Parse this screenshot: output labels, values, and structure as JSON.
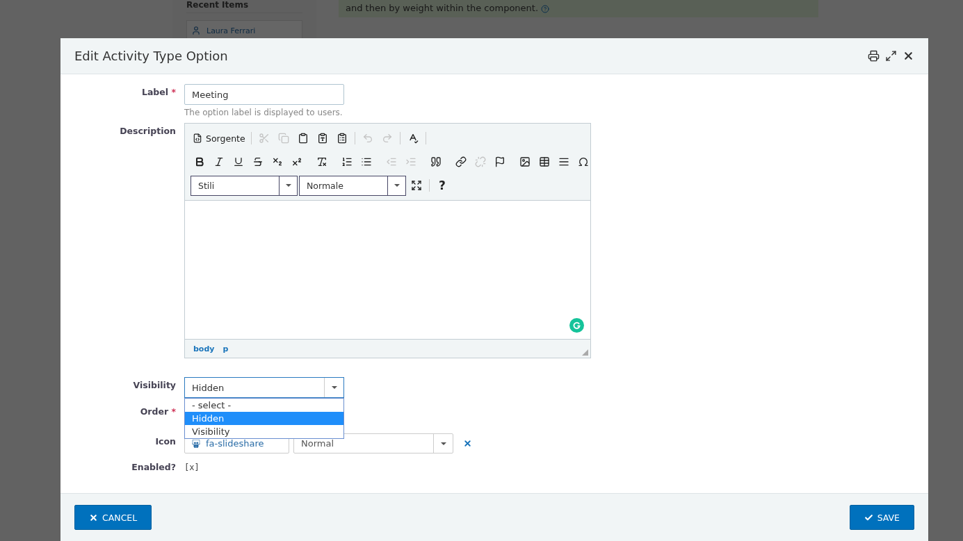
{
  "background": {
    "sidebar_title": "Recent Items",
    "recent_items": [
      "Laura Ferrari"
    ],
    "notice": "and then by weight within the component."
  },
  "dialog": {
    "title": "Edit Activity Type Option",
    "form": {
      "label": {
        "label": "Label",
        "required_mark": "*",
        "value": "Meeting",
        "help": "The option label is displayed to users."
      },
      "description": {
        "label": "Description",
        "toolbar_rows": [
          [
            {
              "kind": "source",
              "text": "Sorgente",
              "disabled": false
            },
            {
              "kind": "sep"
            },
            {
              "kind": "cut",
              "disabled": true
            },
            {
              "kind": "copy",
              "disabled": true
            },
            {
              "kind": "paste",
              "disabled": false
            },
            {
              "kind": "paste-text",
              "disabled": false
            },
            {
              "kind": "paste-word",
              "disabled": false
            },
            {
              "kind": "sep"
            },
            {
              "kind": "undo",
              "disabled": true
            },
            {
              "kind": "redo",
              "disabled": true
            },
            {
              "kind": "sep"
            },
            {
              "kind": "spellcheck",
              "disabled": false
            },
            {
              "kind": "sep"
            }
          ],
          [
            {
              "kind": "bold",
              "disabled": false
            },
            {
              "kind": "italic",
              "disabled": false
            },
            {
              "kind": "underline",
              "disabled": false
            },
            {
              "kind": "strike",
              "disabled": false
            },
            {
              "kind": "subscript",
              "disabled": false
            },
            {
              "kind": "superscript",
              "disabled": false
            },
            {
              "kind": "sep"
            },
            {
              "kind": "remove-format",
              "disabled": false
            },
            {
              "kind": "sep"
            },
            {
              "kind": "ordered-list",
              "disabled": false
            },
            {
              "kind": "bullet-list",
              "disabled": false
            },
            {
              "kind": "sep"
            },
            {
              "kind": "outdent",
              "disabled": true
            },
            {
              "kind": "indent",
              "disabled": true
            },
            {
              "kind": "sep"
            },
            {
              "kind": "quote",
              "disabled": false
            },
            {
              "kind": "sep"
            },
            {
              "kind": "link",
              "disabled": false
            },
            {
              "kind": "unlink",
              "disabled": true
            },
            {
              "kind": "anchor",
              "disabled": false
            },
            {
              "kind": "sep"
            },
            {
              "kind": "image",
              "disabled": false
            },
            {
              "kind": "table",
              "disabled": false
            },
            {
              "kind": "rule",
              "disabled": false
            },
            {
              "kind": "special-char",
              "disabled": false
            }
          ],
          [
            {
              "kind": "combo",
              "text": "Stili"
            },
            {
              "kind": "combo",
              "text": "Normale"
            },
            {
              "kind": "maximize",
              "disabled": false
            },
            {
              "kind": "sep"
            },
            {
              "kind": "help",
              "text": "?",
              "disabled": false
            }
          ]
        ],
        "path": [
          "body",
          "p"
        ]
      },
      "visibility": {
        "label": "Visibility",
        "value": "Hidden",
        "options": [
          {
            "label": "- select -",
            "selected": false
          },
          {
            "label": "Hidden",
            "selected": true
          },
          {
            "label": "Visibility",
            "selected": false
          }
        ]
      },
      "order": {
        "label": "Order",
        "required_mark": "*"
      },
      "icon": {
        "label": "Icon",
        "value": "fa-slideshare",
        "size": "Normal"
      },
      "enabled": {
        "label": "Enabled?",
        "value": "[x]"
      }
    },
    "buttons": [
      {
        "kind": "cancel",
        "label": "CANCEL"
      },
      {
        "kind": "save",
        "label": "SAVE"
      }
    ]
  }
}
